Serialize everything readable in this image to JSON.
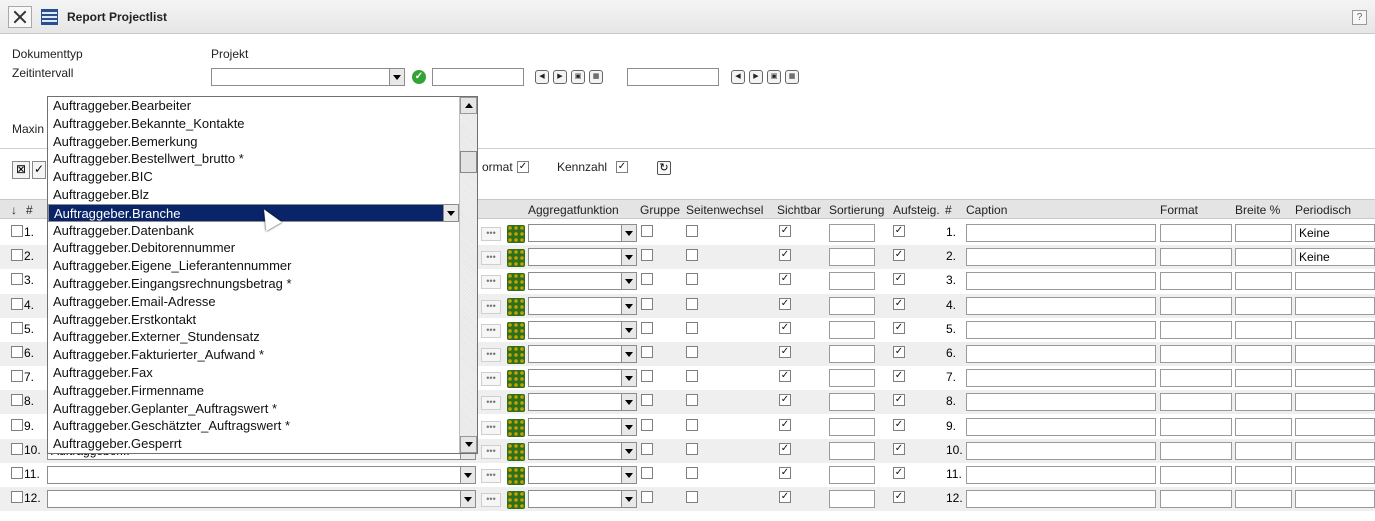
{
  "window": {
    "title": "Report Projectlist",
    "help": "?"
  },
  "form": {
    "doctype_label": "Dokumenttyp",
    "doctype_value": "Projekt",
    "interval_label": "Zeitintervall",
    "max_label": "Maxin",
    "format_label": "ormat",
    "kennzahl_label": "Kennzahl"
  },
  "columns": {
    "num": "#",
    "aggregate": "Aggregatfunktion",
    "group": "Gruppe",
    "pagebreak": "Seitenwechsel",
    "visible": "Sichtbar",
    "sort": "Sortierung",
    "asc": "Aufsteig.",
    "hash": "#",
    "caption": "Caption",
    "format": "Format",
    "width": "Breite %",
    "periodic": "Periodisch"
  },
  "rows": [
    {
      "num": "1.",
      "n2": "1.",
      "periodic": "Keine"
    },
    {
      "num": "2.",
      "n2": "2.",
      "periodic": "Keine"
    },
    {
      "num": "3.",
      "n2": "3.",
      "periodic": ""
    },
    {
      "num": "4.",
      "n2": "4.",
      "periodic": ""
    },
    {
      "num": "5.",
      "n2": "5.",
      "periodic": ""
    },
    {
      "num": "6.",
      "n2": "6.",
      "periodic": ""
    },
    {
      "num": "7.",
      "n2": "7.",
      "periodic": ""
    },
    {
      "num": "8.",
      "n2": "8.",
      "periodic": ""
    },
    {
      "num": "9.",
      "n2": "9.",
      "periodic": ""
    },
    {
      "num": "10.",
      "n2": "10.",
      "periodic": "",
      "field": "Auftraggeber..."
    },
    {
      "num": "11.",
      "n2": "11.",
      "periodic": ""
    },
    {
      "num": "12.",
      "n2": "12.",
      "periodic": ""
    }
  ],
  "dropdown_items": [
    "Auftraggeber.Bearbeiter",
    "Auftraggeber.Bekannte_Kontakte",
    "Auftraggeber.Bemerkung",
    "Auftraggeber.Bestellwert_brutto *",
    "Auftraggeber.BIC",
    "Auftraggeber.Blz",
    "Auftraggeber.Branche",
    "Auftraggeber.Datenbank",
    "Auftraggeber.Debitorennummer",
    "Auftraggeber.Eigene_Lieferantennummer",
    "Auftraggeber.Eingangsrechnungsbetrag *",
    "Auftraggeber.Email-Adresse",
    "Auftraggeber.Erstkontakt",
    "Auftraggeber.Externer_Stundensatz",
    "Auftraggeber.Fakturierter_Aufwand *",
    "Auftraggeber.Fax",
    "Auftraggeber.Firmenname",
    "Auftraggeber.Geplanter_Auftragswert *",
    "Auftraggeber.Geschätzter_Auftragswert *",
    "Auftraggeber.Gesperrt"
  ],
  "selected_item": "Auftraggeber.Branche",
  "colors": {
    "selection": "#0a246a",
    "header_bg": "#e4e4e4",
    "ok": "#34a336"
  }
}
